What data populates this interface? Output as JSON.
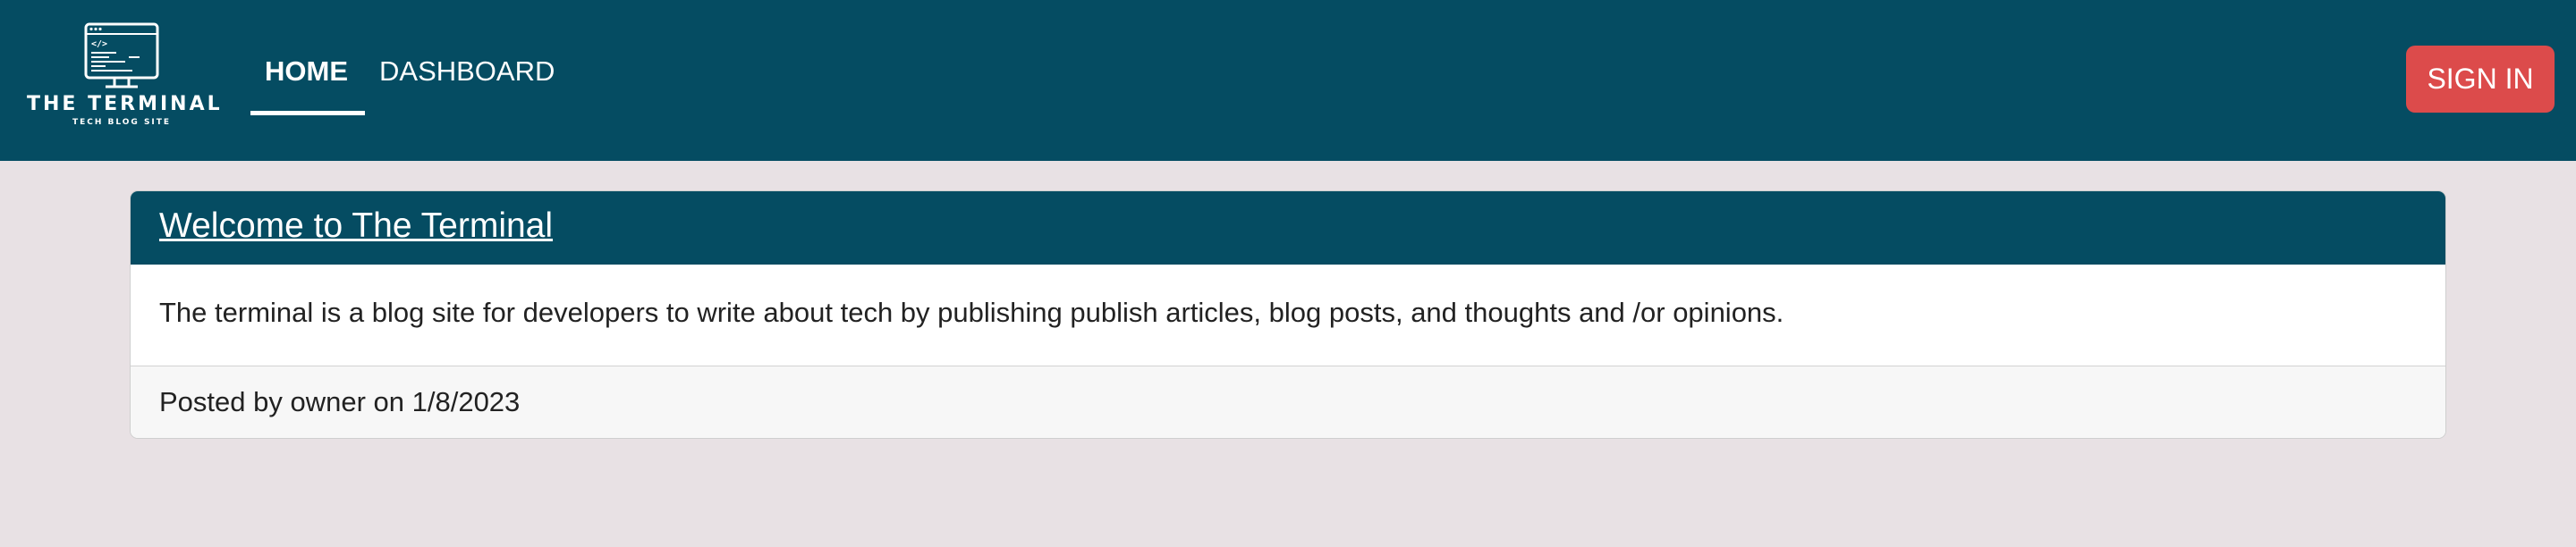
{
  "navbar": {
    "logo": {
      "title": "THE TERMINAL",
      "subtitle": "TECH BLOG SITE",
      "icon": "computer-monitor-code-icon"
    },
    "links": [
      {
        "label": "HOME",
        "active": true
      },
      {
        "label": "DASHBOARD",
        "active": false
      }
    ],
    "signin_label": "SIGN IN"
  },
  "post": {
    "title": "Welcome to The Terminal",
    "body": "The terminal is a blog site for developers to write about tech by publishing publish articles, blog posts, and thoughts and /or opinions.",
    "footer": "Posted by owner on 1/8/2023"
  },
  "colors": {
    "navbar_bg": "#054c62",
    "page_bg": "#e8e1e4",
    "signin_bg": "#dc4b4b",
    "card_header_bg": "#054c62",
    "card_footer_bg": "#f7f7f7"
  }
}
